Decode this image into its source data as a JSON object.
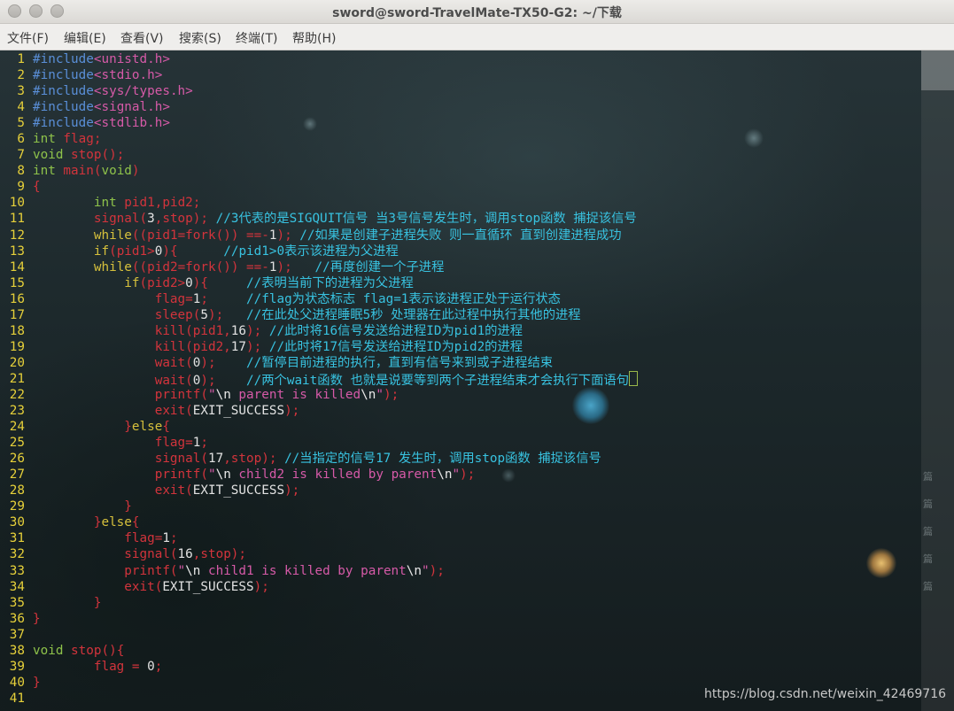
{
  "window": {
    "title": "sword@sword-TravelMate-TX50-G2: ~/下载"
  },
  "menu": [
    {
      "label": "文件(F)"
    },
    {
      "label": "编辑(E)"
    },
    {
      "label": "查看(V)"
    },
    {
      "label": "搜索(S)"
    },
    {
      "label": "终端(T)"
    },
    {
      "label": "帮助(H)"
    }
  ],
  "colors": {
    "line_number": "#e6d03a",
    "preprocessor": "#5a8fd8",
    "string": "#d65aa8",
    "type": "#8ec24a",
    "function": "#d2343c",
    "keyword": "#d6c03c",
    "comment": "#38c2e0",
    "plain": "#e2e2e2"
  },
  "editor": {
    "lines": [
      {
        "n": "1",
        "tokens": [
          [
            "pre",
            "#include"
          ],
          [
            "str",
            "<unistd.h>"
          ]
        ]
      },
      {
        "n": "2",
        "tokens": [
          [
            "pre",
            "#include"
          ],
          [
            "str",
            "<stdio.h>"
          ]
        ]
      },
      {
        "n": "3",
        "tokens": [
          [
            "pre",
            "#include"
          ],
          [
            "str",
            "<sys/types.h>"
          ]
        ]
      },
      {
        "n": "4",
        "tokens": [
          [
            "pre",
            "#include"
          ],
          [
            "str",
            "<signal.h>"
          ]
        ]
      },
      {
        "n": "5",
        "tokens": [
          [
            "pre",
            "#include"
          ],
          [
            "str",
            "<stdlib.h>"
          ]
        ]
      },
      {
        "n": "6",
        "tokens": [
          [
            "typ",
            "int"
          ],
          [
            "fn",
            " flag;"
          ]
        ]
      },
      {
        "n": "7",
        "tokens": [
          [
            "typ",
            "void"
          ],
          [
            "fn",
            " stop();"
          ]
        ]
      },
      {
        "n": "8",
        "tokens": [
          [
            "typ",
            "int"
          ],
          [
            "fn",
            " main("
          ],
          [
            "typ",
            "void"
          ],
          [
            "fn",
            ")"
          ]
        ]
      },
      {
        "n": "9",
        "tokens": [
          [
            "fn",
            "{"
          ]
        ]
      },
      {
        "n": "10",
        "tokens": [
          [
            "fn",
            "        "
          ],
          [
            "typ",
            "int"
          ],
          [
            "fn",
            " pid1,pid2;"
          ]
        ]
      },
      {
        "n": "11",
        "tokens": [
          [
            "fn",
            "        signal("
          ],
          [
            "plain",
            "3"
          ],
          [
            "fn",
            ",stop); "
          ],
          [
            "cmt",
            "//3代表的是SIGQUIT信号 当3号信号发生时，调用stop函数 捕捉该信号"
          ]
        ]
      },
      {
        "n": "12",
        "tokens": [
          [
            "fn",
            "        "
          ],
          [
            "kw",
            "while"
          ],
          [
            "fn",
            "((pid1=fork()) ==-"
          ],
          [
            "plain",
            "1"
          ],
          [
            "fn",
            "); "
          ],
          [
            "cmt",
            "//如果是创建子进程失败 则一直循环 直到创建进程成功"
          ]
        ]
      },
      {
        "n": "13",
        "tokens": [
          [
            "fn",
            "        "
          ],
          [
            "kw",
            "if"
          ],
          [
            "fn",
            "(pid1>"
          ],
          [
            "plain",
            "0"
          ],
          [
            "fn",
            "){      "
          ],
          [
            "cmt",
            "//pid1>0表示该进程为父进程"
          ]
        ]
      },
      {
        "n": "14",
        "tokens": [
          [
            "fn",
            "        "
          ],
          [
            "kw",
            "while"
          ],
          [
            "fn",
            "((pid2=fork()) ==-"
          ],
          [
            "plain",
            "1"
          ],
          [
            "fn",
            ");   "
          ],
          [
            "cmt",
            "//再度创建一个子进程"
          ]
        ]
      },
      {
        "n": "15",
        "tokens": [
          [
            "fn",
            "            "
          ],
          [
            "kw",
            "if"
          ],
          [
            "fn",
            "(pid2>"
          ],
          [
            "plain",
            "0"
          ],
          [
            "fn",
            "){     "
          ],
          [
            "cmt",
            "//表明当前下的进程为父进程"
          ]
        ]
      },
      {
        "n": "16",
        "tokens": [
          [
            "fn",
            "                flag="
          ],
          [
            "plain",
            "1"
          ],
          [
            "fn",
            ";     "
          ],
          [
            "cmt",
            "//flag为状态标志 flag=1表示该进程正处于运行状态"
          ]
        ]
      },
      {
        "n": "17",
        "tokens": [
          [
            "fn",
            "                sleep("
          ],
          [
            "plain",
            "5"
          ],
          [
            "fn",
            ");   "
          ],
          [
            "cmt",
            "//在此处父进程睡眠5秒 处理器在此过程中执行其他的进程"
          ]
        ]
      },
      {
        "n": "18",
        "tokens": [
          [
            "fn",
            "                kill(pid1,"
          ],
          [
            "plain",
            "16"
          ],
          [
            "fn",
            "); "
          ],
          [
            "cmt",
            "//此时将16信号发送给进程ID为pid1的进程"
          ]
        ]
      },
      {
        "n": "19",
        "tokens": [
          [
            "fn",
            "                kill(pid2,"
          ],
          [
            "plain",
            "17"
          ],
          [
            "fn",
            "); "
          ],
          [
            "cmt",
            "//此时将17信号发送给进程ID为pid2的进程"
          ]
        ]
      },
      {
        "n": "20",
        "tokens": [
          [
            "fn",
            "                wait("
          ],
          [
            "plain",
            "0"
          ],
          [
            "fn",
            ");    "
          ],
          [
            "cmt",
            "//暂停目前进程的执行，直到有信号来到或子进程结束"
          ]
        ]
      },
      {
        "n": "21",
        "tokens": [
          [
            "fn",
            "                wait("
          ],
          [
            "plain",
            "0"
          ],
          [
            "fn",
            ");    "
          ],
          [
            "cmt",
            "//两个wait函数 也就是说要等到两个子进程结束才会执行下面语句"
          ]
        ],
        "cursor": true
      },
      {
        "n": "22",
        "tokens": [
          [
            "fn",
            "                printf("
          ],
          [
            "str",
            "\""
          ],
          [
            "esc",
            "\\n"
          ],
          [
            "str",
            " parent is killed"
          ],
          [
            "esc",
            "\\n"
          ],
          [
            "str",
            "\""
          ],
          [
            "fn",
            ");"
          ]
        ]
      },
      {
        "n": "23",
        "tokens": [
          [
            "fn",
            "                exit("
          ],
          [
            "plain",
            "EXIT_SUCCESS"
          ],
          [
            "fn",
            ");"
          ]
        ]
      },
      {
        "n": "24",
        "tokens": [
          [
            "fn",
            "            }"
          ],
          [
            "kw",
            "else"
          ],
          [
            "fn",
            "{"
          ]
        ]
      },
      {
        "n": "25",
        "tokens": [
          [
            "fn",
            "                flag="
          ],
          [
            "plain",
            "1"
          ],
          [
            "fn",
            ";"
          ]
        ]
      },
      {
        "n": "26",
        "tokens": [
          [
            "fn",
            "                signal("
          ],
          [
            "plain",
            "17"
          ],
          [
            "fn",
            ",stop); "
          ],
          [
            "cmt",
            "//当指定的信号17 发生时，调用stop函数 捕捉该信号"
          ]
        ]
      },
      {
        "n": "27",
        "tokens": [
          [
            "fn",
            "                printf("
          ],
          [
            "str",
            "\""
          ],
          [
            "esc",
            "\\n"
          ],
          [
            "str",
            " child2 is killed by parent"
          ],
          [
            "esc",
            "\\n"
          ],
          [
            "str",
            "\""
          ],
          [
            "fn",
            ");"
          ]
        ]
      },
      {
        "n": "28",
        "tokens": [
          [
            "fn",
            "                exit("
          ],
          [
            "plain",
            "EXIT_SUCCESS"
          ],
          [
            "fn",
            ");"
          ]
        ]
      },
      {
        "n": "29",
        "tokens": [
          [
            "fn",
            "            }"
          ]
        ]
      },
      {
        "n": "30",
        "tokens": [
          [
            "fn",
            "        }"
          ],
          [
            "kw",
            "else"
          ],
          [
            "fn",
            "{"
          ]
        ]
      },
      {
        "n": "31",
        "tokens": [
          [
            "fn",
            "            flag="
          ],
          [
            "plain",
            "1"
          ],
          [
            "fn",
            ";"
          ]
        ]
      },
      {
        "n": "32",
        "tokens": [
          [
            "fn",
            "            signal("
          ],
          [
            "plain",
            "16"
          ],
          [
            "fn",
            ",stop);"
          ]
        ]
      },
      {
        "n": "33",
        "tokens": [
          [
            "fn",
            "            printf("
          ],
          [
            "str",
            "\""
          ],
          [
            "esc",
            "\\n"
          ],
          [
            "str",
            " child1 is killed by parent"
          ],
          [
            "esc",
            "\\n"
          ],
          [
            "str",
            "\""
          ],
          [
            "fn",
            ");"
          ]
        ]
      },
      {
        "n": "34",
        "tokens": [
          [
            "fn",
            "            exit("
          ],
          [
            "plain",
            "EXIT_SUCCESS"
          ],
          [
            "fn",
            ");"
          ]
        ]
      },
      {
        "n": "35",
        "tokens": [
          [
            "fn",
            "        }"
          ]
        ]
      },
      {
        "n": "36",
        "tokens": [
          [
            "fn",
            "}"
          ]
        ]
      },
      {
        "n": "37",
        "tokens": []
      },
      {
        "n": "38",
        "tokens": [
          [
            "typ",
            "void"
          ],
          [
            "fn",
            " stop(){"
          ]
        ]
      },
      {
        "n": "39",
        "tokens": [
          [
            "fn",
            "        flag = "
          ],
          [
            "plain",
            "0"
          ],
          [
            "fn",
            ";"
          ]
        ]
      },
      {
        "n": "40",
        "tokens": [
          [
            "fn",
            "}"
          ]
        ]
      },
      {
        "n": "41",
        "tokens": []
      }
    ]
  },
  "sidebar_chars": [
    "篇",
    "篇",
    "篇",
    "篇",
    "篇"
  ],
  "watermark": "https://blog.csdn.net/weixin_42469716"
}
